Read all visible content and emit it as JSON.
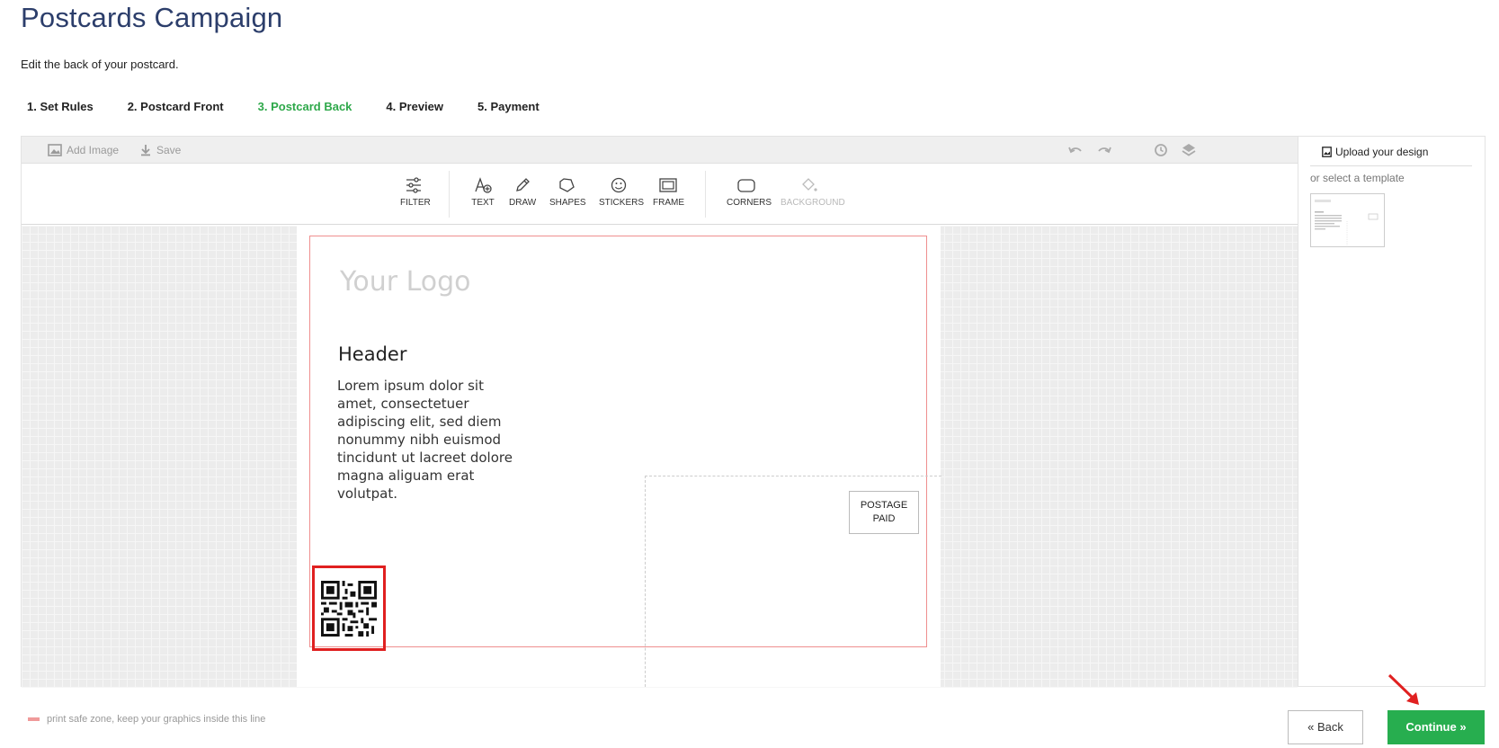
{
  "page": {
    "title": "Postcards Campaign",
    "subtitle": "Edit the back of your postcard."
  },
  "steps": [
    {
      "label": "1. Set Rules"
    },
    {
      "label": "2. Postcard Front"
    },
    {
      "label": "3. Postcard Back",
      "active": true
    },
    {
      "label": "4. Preview"
    },
    {
      "label": "5. Payment"
    }
  ],
  "topbar": {
    "add_image": "Add Image",
    "save": "Save"
  },
  "toolbar": {
    "filter": "FILTER",
    "text": "TEXT",
    "draw": "DRAW",
    "shapes": "SHAPES",
    "stickers": "STICKERS",
    "frame": "FRAME",
    "corners": "CORNERS",
    "background": "BACKGROUND"
  },
  "postcard": {
    "logo": "Your Logo",
    "header": "Header",
    "body": "Lorem ipsum dolor sit amet, consectetuer adipiscing elit, sed diem nonummy nibh euismod tincidunt ut lacreet dolore magna aliguam erat volutpat.",
    "postage_line1": "POSTAGE",
    "postage_line2": "PAID"
  },
  "side": {
    "upload": "Upload your design",
    "or_template": "or select a template"
  },
  "footer": {
    "legend": "print safe zone, keep your graphics inside this line",
    "back": "« Back",
    "continue": "Continue »"
  },
  "colors": {
    "title": "#2c3e6b",
    "active_step": "#2ea84a",
    "continue_bg": "#27ae4f",
    "highlight": "#e02020",
    "safe_zone": "#ef8f8f"
  }
}
